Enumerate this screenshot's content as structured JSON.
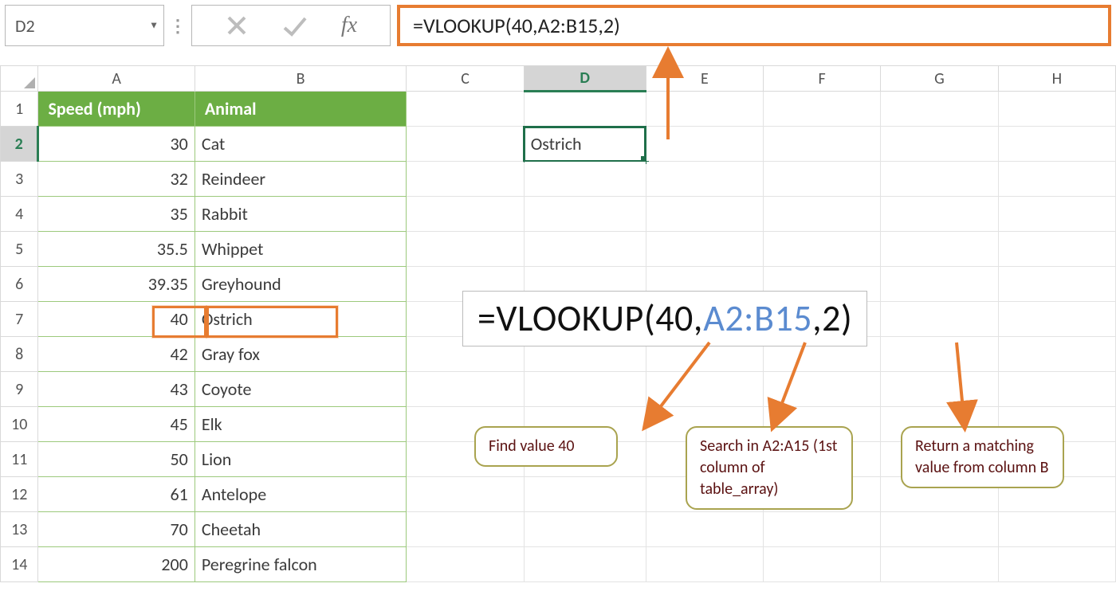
{
  "name_box": {
    "value": "D2"
  },
  "formula_bar": {
    "formula": "=VLOOKUP(40,A2:B15,2)"
  },
  "columns": [
    "A",
    "B",
    "C",
    "D",
    "E",
    "F",
    "G",
    "H"
  ],
  "rows": [
    "1",
    "2",
    "3",
    "4",
    "5",
    "6",
    "7",
    "8",
    "9",
    "10",
    "11",
    "12",
    "13",
    "14"
  ],
  "active_col": "D",
  "active_row": "2",
  "table": {
    "headers": {
      "speed": "Speed (mph)",
      "animal": "Animal"
    },
    "rows": [
      {
        "speed": "30",
        "animal": "Cat"
      },
      {
        "speed": "32",
        "animal": "Reindeer"
      },
      {
        "speed": "35",
        "animal": "Rabbit"
      },
      {
        "speed": "35.5",
        "animal": "Whippet"
      },
      {
        "speed": "39.35",
        "animal": "Greyhound"
      },
      {
        "speed": "40",
        "animal": "Ostrich"
      },
      {
        "speed": "42",
        "animal": "Gray fox"
      },
      {
        "speed": "43",
        "animal": "Coyote"
      },
      {
        "speed": "45",
        "animal": "Elk"
      },
      {
        "speed": "50",
        "animal": "Lion"
      },
      {
        "speed": "61",
        "animal": "Antelope"
      },
      {
        "speed": "70",
        "animal": "Cheetah"
      },
      {
        "speed": "200",
        "animal": "Peregrine falcon"
      }
    ]
  },
  "selected_cell": {
    "ref": "D2",
    "value": "Ostrich"
  },
  "annotation": {
    "big_formula_prefix": "=VLOOKUP(40,",
    "big_formula_range": "A2:B15",
    "big_formula_suffix": ",2)",
    "callout1": "Find value 40",
    "callout2": "Search in A2:A15 (1st column of table_array)",
    "callout3": "Return a matching value from column B"
  }
}
